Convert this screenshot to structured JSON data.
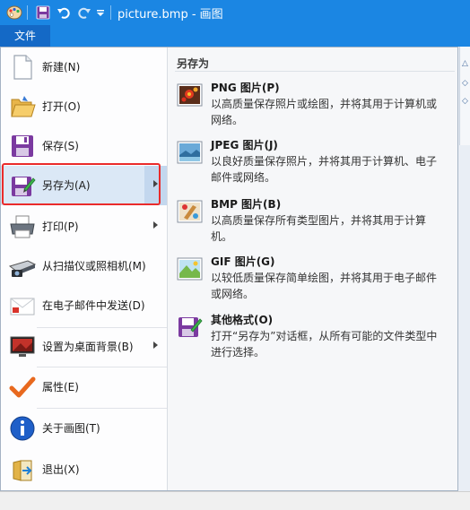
{
  "window": {
    "title": "picture.bmp - 画图"
  },
  "ribbon": {
    "file_tab": "文件"
  },
  "menu": {
    "items": [
      {
        "label": "新建(N)",
        "icon": "new-document-icon"
      },
      {
        "label": "打开(O)",
        "icon": "open-folder-icon"
      },
      {
        "label": "保存(S)",
        "icon": "save-floppy-icon"
      },
      {
        "label": "另存为(A)",
        "icon": "save-as-icon",
        "submenu": true
      },
      {
        "label": "打印(P)",
        "icon": "printer-icon",
        "submenu": true
      },
      {
        "label": "从扫描仪或照相机(M)",
        "icon": "scanner-camera-icon"
      },
      {
        "label": "在电子邮件中发送(D)",
        "icon": "email-icon"
      },
      {
        "label": "设置为桌面背景(B)",
        "icon": "desktop-background-icon",
        "submenu": true
      },
      {
        "label": "属性(E)",
        "icon": "checkmark-icon"
      },
      {
        "label": "关于画图(T)",
        "icon": "info-icon"
      },
      {
        "label": "退出(X)",
        "icon": "exit-icon"
      }
    ]
  },
  "saveas": {
    "title": "另存为",
    "formats": [
      {
        "name": "PNG 图片(P)",
        "desc": "以高质量保存照片或绘图，并将其用于计算机或网络。",
        "icon": "png-image-icon"
      },
      {
        "name": "JPEG 图片(J)",
        "desc": "以良好质量保存照片，并将其用于计算机、电子邮件或网络。",
        "icon": "jpeg-image-icon"
      },
      {
        "name": "BMP 图片(B)",
        "desc": "以高质量保存所有类型图片，并将其用于计算机。",
        "icon": "bmp-image-icon"
      },
      {
        "name": "GIF 图片(G)",
        "desc": "以较低质量保存简单绘图，并将其用于电子邮件或网络。",
        "icon": "gif-image-icon"
      },
      {
        "name": "其他格式(O)",
        "desc": "打开“另存为”对话框，从所有可能的文件类型中进行选择。",
        "icon": "other-formats-icon"
      }
    ]
  },
  "colors": {
    "accent": "#1b86e3",
    "highlight": "#dbe8f6",
    "frame": "#ea2b2b"
  }
}
